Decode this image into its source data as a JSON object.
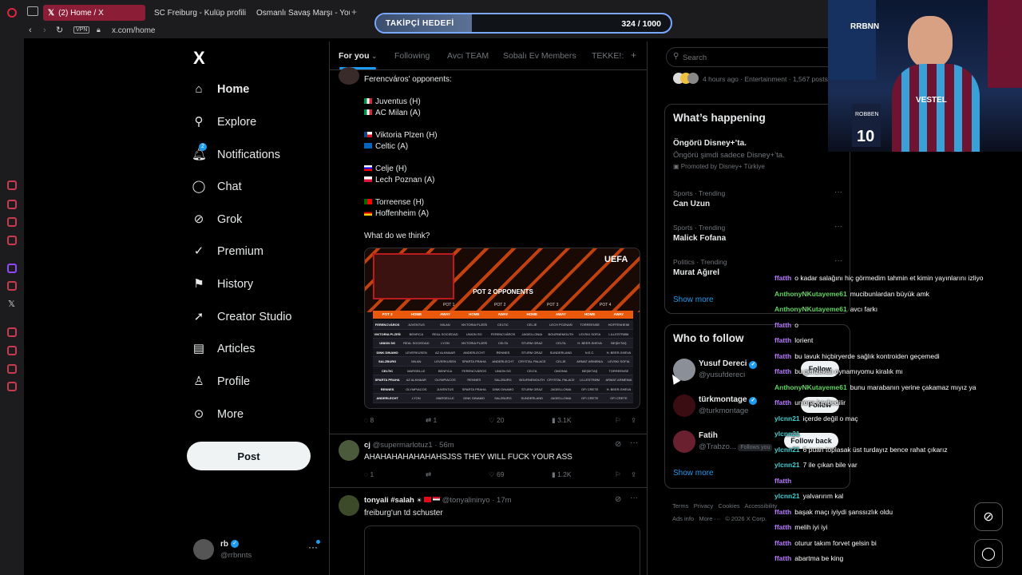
{
  "browser": {
    "tabs": [
      {
        "title": "(2) Home / X"
      },
      {
        "title": "SC Freiburg - Kulüp profili"
      },
      {
        "title": "Osmanlı Savaş Marşı - You"
      }
    ],
    "new_tab": "+",
    "vpn": "VPN",
    "url": "x.com/home"
  },
  "overlay": {
    "title": "TAKİPÇİ HEDEFİ",
    "count": "324 / 1000",
    "progress": 0.324
  },
  "webcam": {
    "jersey_number": "10",
    "brand_text": "RRBNN",
    "sponsor": "VESTEL",
    "name_tag": "ROBBEN"
  },
  "nav": {
    "logo": "X",
    "items": [
      {
        "label": "Home",
        "icon": "home-icon"
      },
      {
        "label": "Explore",
        "icon": "search-icon"
      },
      {
        "label": "Notifications",
        "icon": "bell-icon",
        "badge": "2"
      },
      {
        "label": "Chat",
        "icon": "chat-icon"
      },
      {
        "label": "Grok",
        "icon": "grok-icon"
      },
      {
        "label": "Premium",
        "icon": "verified-icon"
      },
      {
        "label": "History",
        "icon": "bookmark-icon"
      },
      {
        "label": "Creator Studio",
        "icon": "rocket-icon"
      },
      {
        "label": "Articles",
        "icon": "article-icon"
      },
      {
        "label": "Profile",
        "icon": "person-icon"
      },
      {
        "label": "More",
        "icon": "more-circle-icon"
      }
    ],
    "post_label": "Post",
    "account": {
      "name": "rb",
      "handle": "@rrbnnts"
    }
  },
  "feed": {
    "tabs": [
      "For you",
      "Following",
      "Avcı TEAM",
      "Sobalı Ev Members",
      "TEKKE!:"
    ],
    "add_tab": "+",
    "tweet1": {
      "lines": [
        "Ferencváros' opponents:",
        "Juventus (H)",
        "AC Milan (A)",
        "Viktoria Plzen (H)",
        "Celtic (A)",
        "Celje (H)",
        "Lech Poznan (A)",
        "Torreense (H)",
        "Hoffenheim (A)",
        "What do we think?"
      ],
      "image": {
        "brand": "UEFA",
        "heading": "POT 2 OPPONENTS",
        "pot_headers": [
          "POT 1",
          "POT 2",
          "POT 3",
          "POT 4"
        ],
        "sub_headers": [
          "POT 2",
          "HOME",
          "AWAY",
          "HOME",
          "AWAY",
          "HOME",
          "AWAY",
          "HOME",
          "AWAY"
        ],
        "rows": [
          [
            "FERENCVÁROS",
            "JUVENTUS",
            "MILAN",
            "VIKTORIA PLZEŇ",
            "CELTIC",
            "CELJE",
            "LECH POZNAŃ",
            "TORREENSE",
            "HOFFENHEIM"
          ],
          [
            "VIKTORIA PLZEŇ",
            "BENFICA",
            "REAL SOCIEDAD",
            "UNION SG",
            "FERENCVÁROS",
            "JAGIELLONIA",
            "BOURNEMOUTH",
            "LEVSKI SOFIA",
            "LILLESTRØM"
          ],
          [
            "UNION SG",
            "REAL SOCIEDAD",
            "LYON",
            "VIKTORIA PLZEŇ",
            "CELTA",
            "STURM GRAZ",
            "CELTA",
            "H. BEER-SHEVA",
            "BEŞİKTAŞ"
          ],
          [
            "DINK DINAMO",
            "LEVERKUSEN",
            "AZ ALKMAAR",
            "ANDERLECHT",
            "RENNES",
            "STURM GRAZ",
            "SUNDERLAND",
            "N.E.C.",
            "H. BEER-SHEVA"
          ],
          [
            "SALZBURG",
            "MILAN",
            "LEVERKUSEN",
            "SPARTA PRAHA",
            "ANDERLECHT",
            "CRYSTAL PALACE",
            "CELJE",
            "ARMAT ARMENIA",
            "LEVSKI SOFIA"
          ],
          [
            "CELTIC",
            "MARSEILLE",
            "BENFICA",
            "FERENCVÁROS",
            "UNION SG",
            "CELTA",
            "OMONIA",
            "BEŞİKTAŞ",
            "TORREENSE"
          ],
          [
            "SPARTA PRAHA",
            "AZ ALKMAAR",
            "OLYMPIACOS",
            "RENNES",
            "SALZBURG",
            "BOURNEMOUTH",
            "CRYSTAL PALACE",
            "LILLESTRØM",
            "ARMAT ARMENIA"
          ],
          [
            "RENNES",
            "OLYMPIACOS",
            "JUVENTUS",
            "SPARTA PRAHA",
            "DINK DINAMO",
            "STURM GRAZ",
            "JAGIELLONIA",
            "OFI CRETE",
            "H. BEER-SHEVA"
          ],
          [
            "ANDERLECHT",
            "LYON",
            "MARSEILLE",
            "DINK DINAMO",
            "SALZBURG",
            "SUNDERLAND",
            "JAGIELLONIA",
            "OFI CRETE",
            "OFI CRETE"
          ]
        ]
      },
      "stats": {
        "replies": "8",
        "reposts": "1",
        "likes": "20",
        "views": "3.1K"
      }
    },
    "tweet2": {
      "name": "cj",
      "handle": "@supermarlotuz1",
      "time": "56m",
      "text": "AHAHAHAHAHAHAHSJSS THEY WILL FUCK YOUR ASS",
      "stats": {
        "replies": "1",
        "reposts": "",
        "likes": "69",
        "views": "1.2K"
      }
    },
    "tweet3": {
      "name": "tonyali #salah",
      "handle": "@tonyalininyo",
      "time": "17m",
      "text": "freiburg'un td schuster"
    }
  },
  "sidebar": {
    "search_placeholder": "Search",
    "top_meta": "4 hours ago · Entertainment · 1,567 posts",
    "happening": {
      "title": "What’s happening",
      "promo": {
        "title": "Öngörü Disney+’ta.",
        "subtitle": "Öngörü şimdi sadece Disney+’ta.",
        "promoted": "Promoted by Disney+ Türkiye"
      },
      "trends": [
        {
          "meta": "Sports · Trending",
          "name": "Can Uzun"
        },
        {
          "meta": "Sports · Trending",
          "name": "Malick Fofana"
        },
        {
          "meta": "Politics · Trending",
          "name": "Murat Ağırel"
        }
      ],
      "show_more": "Show more"
    },
    "who_to_follow": {
      "title": "Who to follow",
      "users": [
        {
          "name": "Yusuf Dereci",
          "handle": "@yusufdereci",
          "button": "Follow"
        },
        {
          "name": "türkmontage",
          "handle": "@turkmontage",
          "button": "Follow"
        },
        {
          "name": "Fatih",
          "handle": "@Trabzo...",
          "follows_you": "Follows you",
          "button": "Follow back"
        }
      ],
      "show_more": "Show more"
    },
    "footer": [
      "Terms",
      "Privacy",
      "Cookies",
      "Accessibility",
      "Ads info",
      "More ···",
      "© 2026 X Corp."
    ]
  },
  "chat": [
    {
      "user": "ffatth",
      "color": "#b77cff",
      "msg": "o kadar salağını hiç görmedim tahmin et kimin yayınlarını izliyo"
    },
    {
      "user": "AnthonyNKutayeme61",
      "color": "#5fd35f",
      "msg": "mucibunlardan büyük amk"
    },
    {
      "user": "AnthonyNKutayeme61",
      "color": "#5fd35f",
      "msg": "avcı farkı"
    },
    {
      "user": "ffatth",
      "color": "#b77cff",
      "msg": "o"
    },
    {
      "user": "ffatth",
      "color": "#b77cff",
      "msg": "lorient"
    },
    {
      "user": "ffatth",
      "color": "#b77cff",
      "msg": "bu lavuk hiçbiryerde sağlık kontroiden geçemedi"
    },
    {
      "user": "ffatth",
      "color": "#b77cff",
      "msg": "bu gerizekalı oynamıyomu kiralık mı"
    },
    {
      "user": "AnthonyNKutayeme61",
      "color": "#5fd35f",
      "msg": "bunu marabanın yerine çakamaz mıyız ya"
    },
    {
      "user": "ffatth",
      "color": "#b77cff",
      "msg": "uniona kaybedilir"
    },
    {
      "user": "ylcnn21",
      "color": "#3fd0d0",
      "msg": "içerde değil o maç"
    },
    {
      "user": "ylcnn21",
      "color": "#3fd0d0",
      "msg": ""
    },
    {
      "user": "ylcnn21",
      "color": "#3fd0d0",
      "msg": "6 puan toplasak üst turdayız bence rahat çıkarız"
    },
    {
      "user": "ylcnn21",
      "color": "#3fd0d0",
      "msg": "7 ile çıkan bile var"
    },
    {
      "user": "ffatth",
      "color": "#b77cff",
      "msg": ""
    },
    {
      "user": "ylcnn21",
      "color": "#3fd0d0",
      "msg": "yalvarırım kal"
    },
    {
      "user": "ffatth",
      "color": "#b77cff",
      "msg": "başak maçı iyiydi şanssızlık oldu"
    },
    {
      "user": "ffatth",
      "color": "#b77cff",
      "msg": "melih iyi iyi"
    },
    {
      "user": "ffatth",
      "color": "#b77cff",
      "msg": "oturur takım forvet gelsin bi"
    },
    {
      "user": "ffatth",
      "color": "#b77cff",
      "msg": "abartma be king"
    }
  ],
  "colors": {
    "accent": "#1d9bf0",
    "tab_active": "#8b1d36",
    "overlay_border": "#7aa7ff"
  }
}
